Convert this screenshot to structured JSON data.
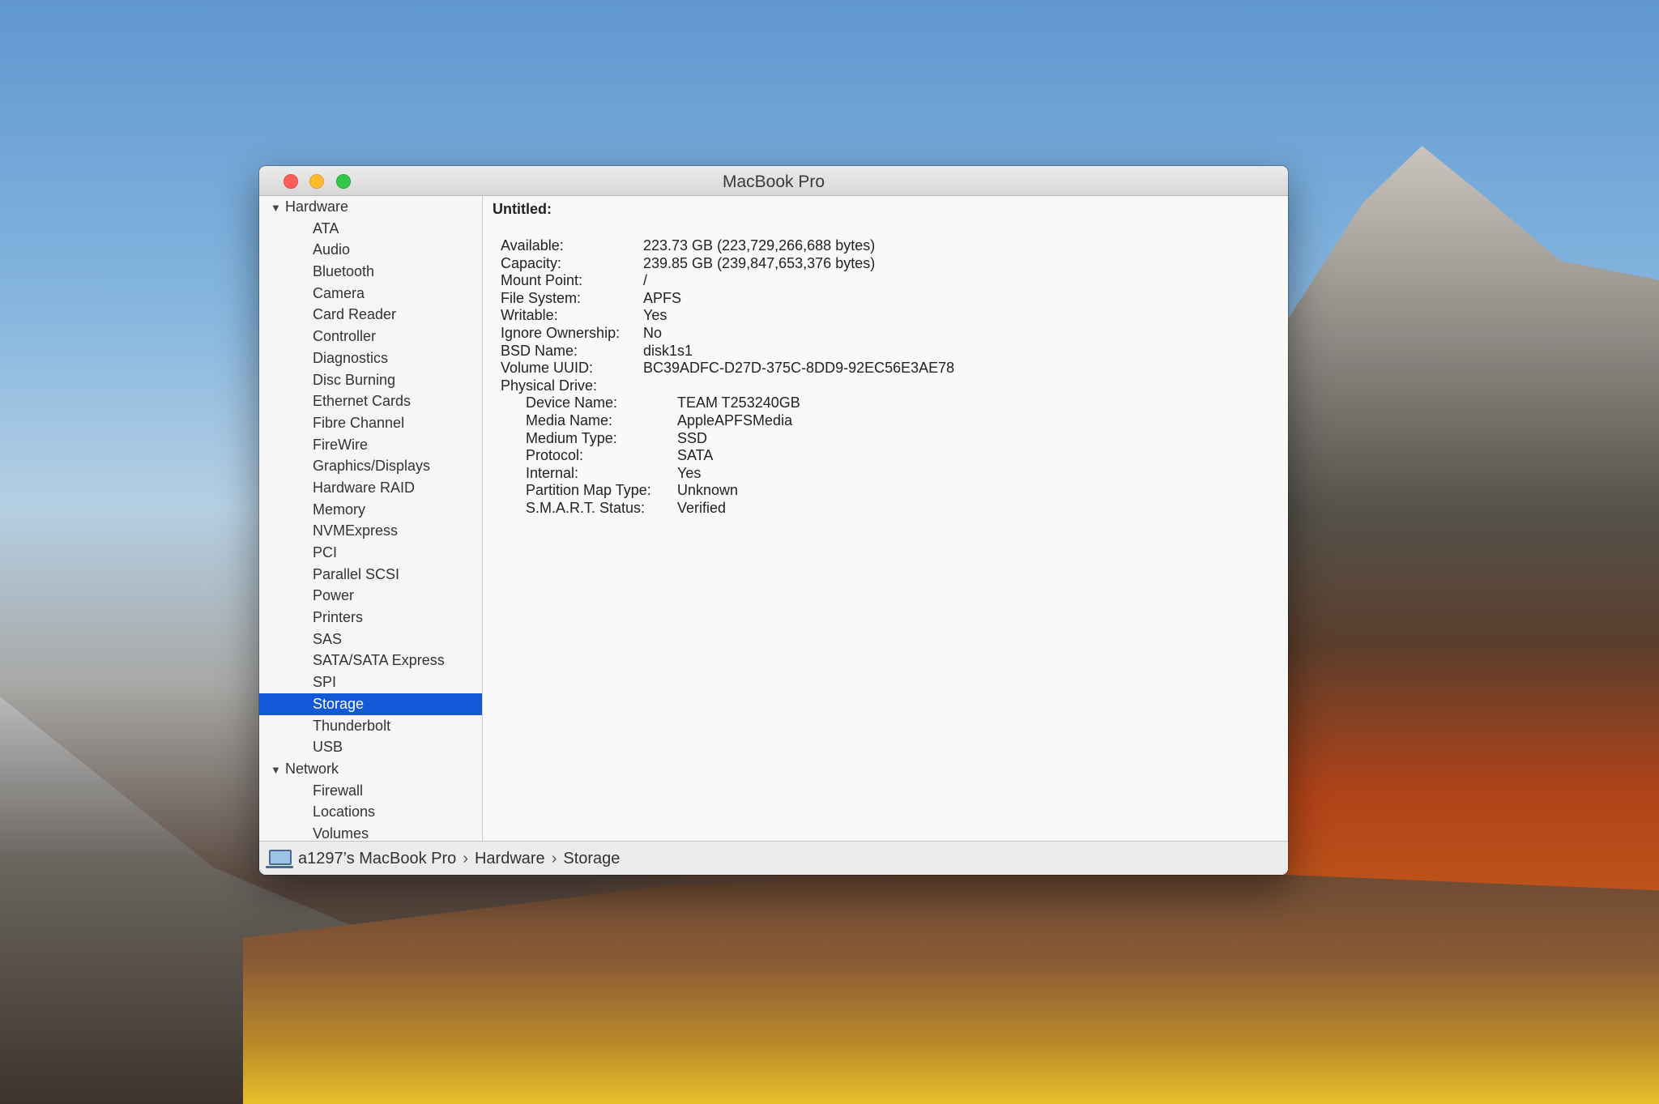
{
  "window": {
    "title": "MacBook Pro"
  },
  "sidebar": {
    "groups": [
      {
        "label": "Hardware",
        "items": [
          "ATA",
          "Audio",
          "Bluetooth",
          "Camera",
          "Card Reader",
          "Controller",
          "Diagnostics",
          "Disc Burning",
          "Ethernet Cards",
          "Fibre Channel",
          "FireWire",
          "Graphics/Displays",
          "Hardware RAID",
          "Memory",
          "NVMExpress",
          "PCI",
          "Parallel SCSI",
          "Power",
          "Printers",
          "SAS",
          "SATA/SATA Express",
          "SPI",
          "Storage",
          "Thunderbolt",
          "USB"
        ]
      },
      {
        "label": "Network",
        "items": [
          "Firewall",
          "Locations",
          "Volumes"
        ]
      }
    ],
    "selected": "Storage"
  },
  "content": {
    "heading": "Untitled:",
    "fields": [
      {
        "k": "Available:",
        "v": "223.73 GB (223,729,266,688 bytes)"
      },
      {
        "k": "Capacity:",
        "v": "239.85 GB (239,847,653,376 bytes)"
      },
      {
        "k": "Mount Point:",
        "v": "/"
      },
      {
        "k": "File System:",
        "v": "APFS"
      },
      {
        "k": "Writable:",
        "v": "Yes"
      },
      {
        "k": "Ignore Ownership:",
        "v": "No"
      },
      {
        "k": "BSD Name:",
        "v": "disk1s1"
      },
      {
        "k": "Volume UUID:",
        "v": "BC39ADFC-D27D-375C-8DD9-92EC56E3AE78"
      },
      {
        "k": "Physical Drive:",
        "v": ""
      }
    ],
    "physical": [
      {
        "k": "Device Name:",
        "v": "TEAM T253240GB"
      },
      {
        "k": "Media Name:",
        "v": "AppleAPFSMedia"
      },
      {
        "k": "Medium Type:",
        "v": "SSD"
      },
      {
        "k": "Protocol:",
        "v": "SATA"
      },
      {
        "k": "Internal:",
        "v": "Yes"
      },
      {
        "k": "Partition Map Type:",
        "v": "Unknown"
      },
      {
        "k": "S.M.A.R.T. Status:",
        "v": "Verified"
      }
    ]
  },
  "pathbar": {
    "items": [
      "a1297’s MacBook Pro",
      "Hardware",
      "Storage"
    ],
    "separator": "›"
  },
  "icons": {
    "disclosure": "triangle-down-icon",
    "computer": "laptop-icon",
    "cursor": "ibeam-cursor-icon"
  },
  "colors": {
    "selection": "#1358d6",
    "close": "#fc5f57",
    "minimize": "#fdbc2e",
    "zoom": "#33c748"
  }
}
